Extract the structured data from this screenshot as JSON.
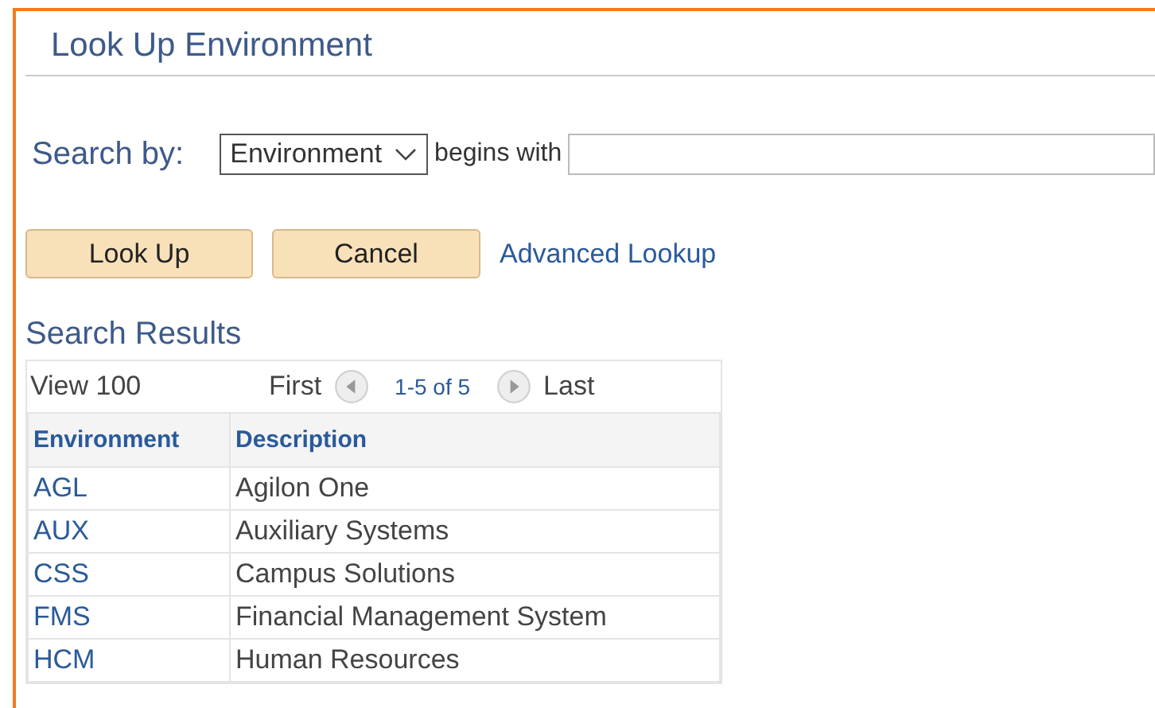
{
  "title": "Look Up Environment",
  "search": {
    "label": "Search by:",
    "field": "Environment",
    "operator": "begins with"
  },
  "actions": [
    {
      "label": "Look Up",
      "kind": "button"
    },
    {
      "label": "Cancel",
      "kind": "button"
    },
    {
      "label": "Advanced Lookup",
      "kind": "link"
    }
  ],
  "results": {
    "heading": "Search Results",
    "view": "View 100",
    "first": "First",
    "range": "1-5 of 5",
    "last": "Last",
    "columns": [
      "Environment",
      "Description"
    ],
    "rows": [
      [
        "AGL",
        "Agilon One"
      ],
      [
        "AUX",
        "Auxiliary Systems"
      ],
      [
        "CSS",
        "Campus Solutions"
      ],
      [
        "FMS",
        "Financial Management System"
      ],
      [
        "HCM",
        "Human Resources"
      ]
    ]
  }
}
